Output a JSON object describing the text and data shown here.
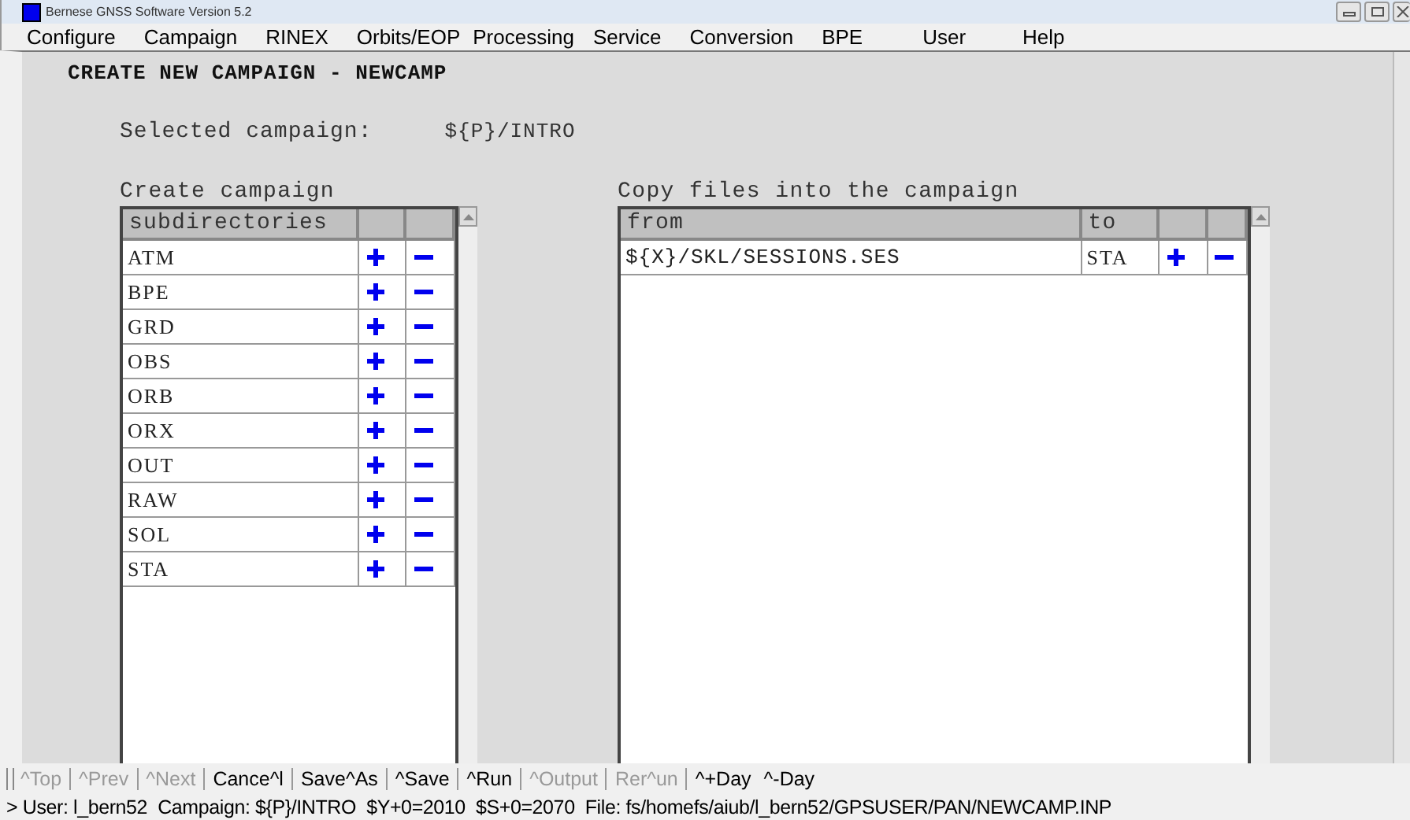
{
  "window": {
    "title": "Bernese GNSS Software Version 5.2"
  },
  "menu": [
    "Configure",
    "Campaign",
    "RINEX",
    "Orbits/EOP",
    "Processing",
    "Service",
    "Conversion",
    "BPE",
    "User",
    "Help"
  ],
  "panel": {
    "title": "CREATE NEW CAMPAIGN - NEWCAMP",
    "selected_label": "Selected campaign:",
    "selected_value": "${P}/INTRO",
    "create": {
      "caption": "Create campaign",
      "column": "subdirectories",
      "rows": [
        "ATM",
        "BPE",
        "GRD",
        "OBS",
        "ORB",
        "ORX",
        "OUT",
        "RAW",
        "SOL",
        "STA"
      ]
    },
    "copy": {
      "caption": "Copy files into the campaign",
      "columns": [
        "from",
        "to"
      ],
      "rows": [
        {
          "from": "${X}/SKL/SESSIONS.SES",
          "to": "STA"
        }
      ]
    }
  },
  "toolbar": [
    {
      "label": "^Top",
      "disabled": true,
      "separator_before": false
    },
    {
      "label": "^Prev",
      "disabled": true,
      "separator_before": true
    },
    {
      "label": "^Next",
      "disabled": true,
      "separator_before": true
    },
    {
      "label": "Cance^l",
      "disabled": false,
      "separator_before": true
    },
    {
      "label": "Save^As",
      "disabled": false,
      "separator_before": true
    },
    {
      "label": "^Save",
      "disabled": false,
      "separator_before": true
    },
    {
      "label": "^Run",
      "disabled": false,
      "separator_before": true
    },
    {
      "label": "^Output",
      "disabled": true,
      "separator_before": true
    },
    {
      "label": "Rer^un",
      "disabled": true,
      "separator_before": true
    },
    {
      "label": "^+Day",
      "disabled": false,
      "separator_before": true
    },
    {
      "label": "^-Day",
      "disabled": false,
      "separator_before": false
    }
  ],
  "status_bar": "> User: l_bern52  Campaign: ${P}/INTRO  $Y+0=2010  $S+0=2070  File: fs/homefs/aiub/l_bern52/GPSUSER/PAN/NEWCAMP.INP"
}
